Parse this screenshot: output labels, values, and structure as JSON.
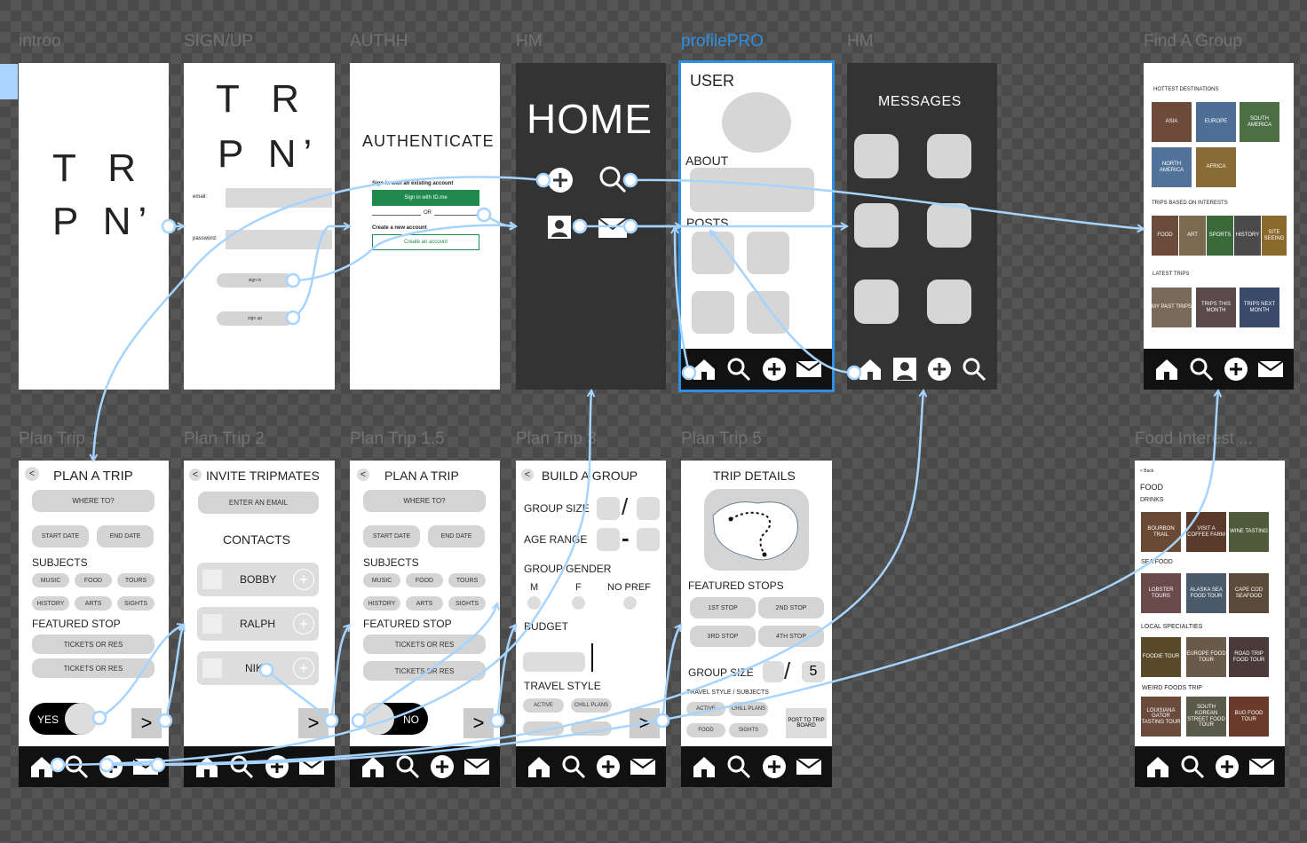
{
  "frame_labels": [
    "introo",
    "SIGN/UP",
    "AUTHH",
    "HM",
    "profilePRO",
    "HM",
    "Find A Group",
    "Plan Trip 1",
    "Plan Trip 2",
    "Plan Trip 1.5",
    "Plan Trip 3",
    "Plan Trip 5",
    "Food Interest ..."
  ],
  "brand": {
    "line1": "T R",
    "line2": "P N’"
  },
  "signup": {
    "email_label": "email:",
    "password_label": "password:",
    "signin": "sign in",
    "signup": "sign up"
  },
  "auth": {
    "title": "AUTHENTICATE",
    "existing": "Sign in with an existing account",
    "signin_btn": "Sign in with ID.me",
    "or": "OR",
    "create": "Create a new account",
    "create_btn": "Create an account"
  },
  "home": {
    "title": "HOME"
  },
  "profile": {
    "user": "USER",
    "about": "ABOUT",
    "posts": "POSTS"
  },
  "messages": {
    "title": "MESSAGES"
  },
  "find_group": {
    "hottest": "HOTTEST DESTINATIONS",
    "destinations": [
      "ASIA",
      "EUROPE",
      "SOUTH AMERICA",
      "NORTH AMERICA",
      "AFRICA"
    ],
    "interests": "TRIPS BASED ON INTERESTS",
    "interest_items": [
      "FOOD",
      "ART",
      "SPORTS",
      "HISTORY",
      "SITE SEEING"
    ],
    "latest": "LATEST TRIPS",
    "latest_items": [
      "MY PAST TRIPS",
      "TRIPS THIS MONTH",
      "TRIPS NEXT MONTH"
    ]
  },
  "plan1": {
    "back": "<",
    "title": "PLAN A TRIP",
    "where": "WHERE TO?",
    "start": "START DATE",
    "end": "END DATE",
    "subjects": "SUBJECTS",
    "subject_items": [
      "MUSIC",
      "FOOD",
      "TOURS",
      "HISTORY",
      "ARTS",
      "SIGHTS"
    ],
    "featured": "FEATURED STOP",
    "tickets": "TICKETS OR RES",
    "toggle": "YES",
    "next": ">"
  },
  "plan2": {
    "back": "<",
    "title": "INVITE TRIPMATES",
    "enter_email": "ENTER AN EMAIL",
    "contacts": "CONTACTS",
    "contact_names": [
      "BOBBY",
      "RALPH",
      "NIK"
    ],
    "next": ">"
  },
  "plan15": {
    "toggle": "NO"
  },
  "plan3": {
    "back": "<",
    "title": "BUILD A GROUP",
    "group_size": "GROUP SIZE",
    "slash": "/",
    "age_range": "AGE RANGE",
    "dash": "-",
    "gender": "GROUP GENDER",
    "genders": [
      "M",
      "F",
      "NO PREF"
    ],
    "budget": "BUDGET",
    "travel_style": "TRAVEL STYLE",
    "styles": [
      "ACTIVE",
      "CHILL PLANS"
    ],
    "next": ">"
  },
  "plan5": {
    "title": "TRIP DETAILS",
    "featured": "FEATURED STOPS",
    "stops": [
      "1ST STOP",
      "2ND STOP",
      "3RD STOP",
      "4TH STOP"
    ],
    "group_size": "GROUP SIZE",
    "slash": "/",
    "size_value": "5",
    "travel_style": "TRAVEL STYLE / SUBJECTS",
    "style_items": [
      "ACTIVE",
      "CHILL PLANS",
      "FOOD",
      "SIGHTS"
    ],
    "post": "POST TO TRIP BOARD"
  },
  "food": {
    "back": "< Back",
    "food": "FOOD",
    "drinks": "DRINKS",
    "drink_items": [
      "BOURBON TRAIL",
      "VISIT A COFFEE FARM",
      "WINE TASTING"
    ],
    "seafood": "SEA FOOD",
    "seafood_items": [
      "LOBSTER TOURS",
      "ALASKA SEA FOOD TOUR",
      "CAPE COD SEAFOOD"
    ],
    "local": "LOCAL SPECIALTIES",
    "local_items": [
      "FOODIE TOUR",
      "EUROPE FOOD TOUR",
      "ROAD TRIP FOOD TOUR"
    ],
    "weird": "WEIRD FOODS TRIP",
    "weird_items": [
      "LOUISIANA GATOR TASTING TOUR",
      "SOUTH KOREAN STREET FOOD TOUR",
      "BUG FOOD TOUR"
    ]
  },
  "colors": {
    "link": "#a6d4ff",
    "selection": "#2f8fe0",
    "dark_frame": "#333333",
    "navbar": "#111111",
    "idme_green": "#1f8a4c"
  }
}
